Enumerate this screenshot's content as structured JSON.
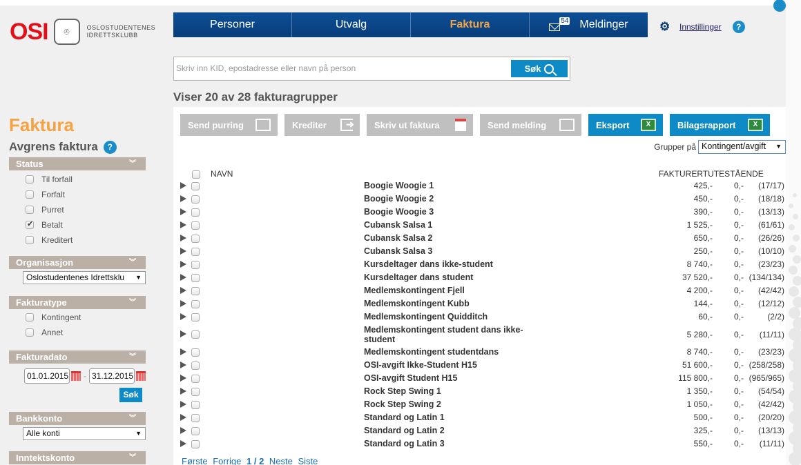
{
  "logo": {
    "brand": "OSI",
    "org_line1": "OSLOSTUDENTENES",
    "org_line2": "IDRETTSKLUBB"
  },
  "nav": {
    "items": [
      {
        "label": "Personer",
        "active": false
      },
      {
        "label": "Utvalg",
        "active": false
      },
      {
        "label": "Faktura",
        "active": true
      },
      {
        "label": "Meldinger",
        "active": false,
        "badge": "54"
      }
    ],
    "settings_label": "Innstillinger",
    "help": "?"
  },
  "search": {
    "placeholder": "Skriv inn KID, epostadresse eller navn på person",
    "value": "",
    "button_label": "Søk"
  },
  "result_heading": "Viser 20 av 28 fakturagrupper",
  "sidebar": {
    "title": "Faktura",
    "subtitle": "Avgrens faktura",
    "help": "?",
    "status": {
      "label": "Status",
      "options": [
        {
          "label": "Til forfall",
          "checked": false
        },
        {
          "label": "Forfalt",
          "checked": false
        },
        {
          "label": "Purret",
          "checked": false
        },
        {
          "label": "Betalt",
          "checked": true
        },
        {
          "label": "Kreditert",
          "checked": false
        }
      ]
    },
    "organisasjon": {
      "label": "Organisasjon",
      "selected": "Oslostudentenes Idrettsklu"
    },
    "fakturatype": {
      "label": "Fakturatype",
      "options": [
        {
          "label": "Kontingent",
          "checked": false
        },
        {
          "label": "Annet",
          "checked": false
        }
      ]
    },
    "fakturadato": {
      "label": "Fakturadato",
      "from": "01.01.2015",
      "to": "31.12.2015",
      "separator": "-",
      "button_label": "Søk"
    },
    "bankkonto": {
      "label": "Bankkonto",
      "selected": "Alle konti"
    },
    "inntektskonto": {
      "label": "Inntektskonto"
    }
  },
  "toolbar": {
    "buttons": [
      {
        "label": "Send purring",
        "enabled": false,
        "icon": "mail-alert-icon"
      },
      {
        "label": "Krediter",
        "enabled": false,
        "icon": "exit-arrow-icon"
      },
      {
        "label": "Skriv ut faktura",
        "enabled": false,
        "icon": "pdf-icon"
      },
      {
        "label": "Send melding",
        "enabled": false,
        "icon": "mail-icon"
      },
      {
        "label": "Eksport",
        "enabled": true,
        "icon": "excel-icon"
      },
      {
        "label": "Bilagsrapport",
        "enabled": true,
        "icon": "excel-icon"
      }
    ],
    "group_by_label": "Grupper på",
    "group_by_selected": "Kontingent/avgift"
  },
  "table": {
    "headers": {
      "name": "NAVN",
      "amounts": "FAKTURERTUTESTÅENDE"
    },
    "rows": [
      {
        "name": "Boogie Woogie 1",
        "invoiced": "425,-",
        "outstanding": "0,-",
        "count": "(17/17)"
      },
      {
        "name": "Boogie Woogie 2",
        "invoiced": "450,-",
        "outstanding": "0,-",
        "count": "(18/18)"
      },
      {
        "name": "Boogie Woogie 3",
        "invoiced": "390,-",
        "outstanding": "0,-",
        "count": "(13/13)"
      },
      {
        "name": "Cubansk Salsa 1",
        "invoiced": "1 525,-",
        "outstanding": "0,-",
        "count": "(61/61)"
      },
      {
        "name": "Cubansk Salsa 2",
        "invoiced": "650,-",
        "outstanding": "0,-",
        "count": "(26/26)"
      },
      {
        "name": "Cubansk Salsa 3",
        "invoiced": "250,-",
        "outstanding": "0,-",
        "count": "(10/10)"
      },
      {
        "name": "Kursdeltager dans ikke-student",
        "invoiced": "8 740,-",
        "outstanding": "0,-",
        "count": "(23/23)"
      },
      {
        "name": "Kursdeltager dans student",
        "invoiced": "37 520,-",
        "outstanding": "0,-",
        "count": "(134/134)"
      },
      {
        "name": "Medlemskontingent Fjell",
        "invoiced": "4 200,-",
        "outstanding": "0,-",
        "count": "(42/42)"
      },
      {
        "name": "Medlemskontingent Kubb",
        "invoiced": "144,-",
        "outstanding": "0,-",
        "count": "(12/12)"
      },
      {
        "name": "Medlemskontingent Quidditch",
        "invoiced": "60,-",
        "outstanding": "0,-",
        "count": "(2/2)"
      },
      {
        "name": "Medlemskontingent student dans ikke-student",
        "invoiced": "5 280,-",
        "outstanding": "0,-",
        "count": "(11/11)"
      },
      {
        "name": "Medlemskontingent studentdans",
        "invoiced": "8 740,-",
        "outstanding": "0,-",
        "count": "(23/23)"
      },
      {
        "name": "OSI-avgift Ikke-Student H15",
        "invoiced": "51 600,-",
        "outstanding": "0,-",
        "count": "(258/258)"
      },
      {
        "name": "OSI-avgift Student H15",
        "invoiced": "115 800,-",
        "outstanding": "0,-",
        "count": "(965/965)"
      },
      {
        "name": "Rock Step Swing 1",
        "invoiced": "1 350,-",
        "outstanding": "0,-",
        "count": "(54/54)"
      },
      {
        "name": "Rock Step Swing 2",
        "invoiced": "1 050,-",
        "outstanding": "0,-",
        "count": "(42/42)"
      },
      {
        "name": "Standard og Latin 1",
        "invoiced": "500,-",
        "outstanding": "0,-",
        "count": "(20/20)"
      },
      {
        "name": "Standard og Latin 2",
        "invoiced": "325,-",
        "outstanding": "0,-",
        "count": "(13/13)"
      },
      {
        "name": "Standard og Latin 3",
        "invoiced": "550,-",
        "outstanding": "0,-",
        "count": "(11/11)"
      }
    ]
  },
  "pager": {
    "first": "Første",
    "prev": "Forrige",
    "current": "1 / 2",
    "next": "Neste",
    "last": "Siste"
  }
}
